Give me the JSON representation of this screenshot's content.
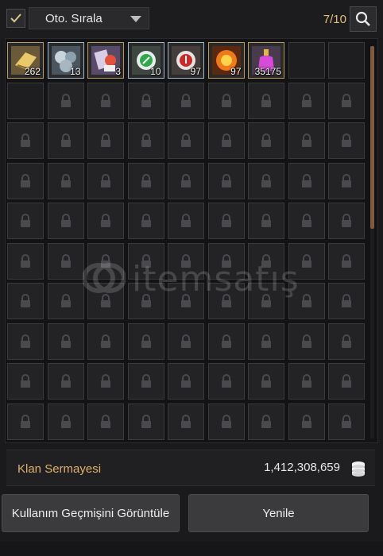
{
  "toolbar": {
    "auto_sort_checked": true,
    "sort_label": "Oto. Sırala",
    "capacity": "7/10",
    "search_icon": "search-icon"
  },
  "inventory": {
    "items": [
      {
        "name": "scroll-item",
        "count": "262",
        "icon": "scroll-icon"
      },
      {
        "name": "orb-bundle-item",
        "count": "13",
        "icon": "orbs-icon"
      },
      {
        "name": "spirit-card-item",
        "count": "3",
        "icon": "card-icon"
      },
      {
        "name": "green-ring-item",
        "count": "10",
        "icon": "green-ring-icon"
      },
      {
        "name": "red-ring-item",
        "count": "97",
        "icon": "red-ring-icon"
      },
      {
        "name": "fire-orb-item",
        "count": "97",
        "icon": "fire-orb-icon"
      },
      {
        "name": "pink-potion-item",
        "count": "35175",
        "icon": "potion-icon"
      }
    ],
    "unlocked_empty_slots": 3,
    "locked_slot_icon": "lock-icon"
  },
  "watermark": {
    "text": "itemsatış"
  },
  "clan": {
    "label": "Klan Sermayesi",
    "value": "1,412,308,659",
    "icon": "coin-stack-icon"
  },
  "buttons": {
    "history": "Kullanım Geçmişini Görüntüle",
    "refresh": "Yenile"
  },
  "colors": {
    "accent_gold": "#e0b06a",
    "scroll_thumb": "#7d5a3f",
    "item_border": "#b69a5e"
  }
}
